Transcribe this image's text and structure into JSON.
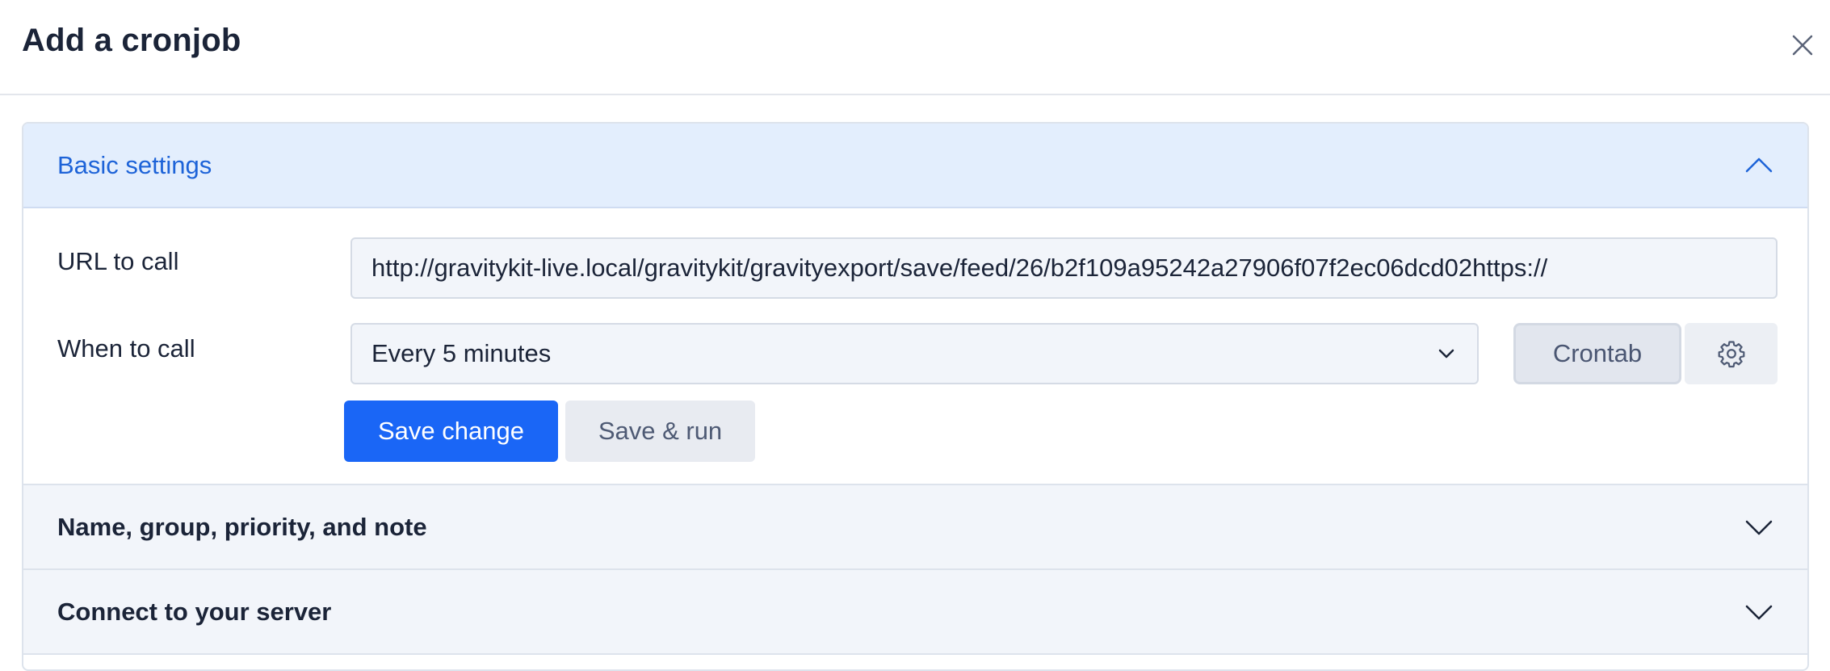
{
  "dialog": {
    "title": "Add a cronjob",
    "close_icon": "close-icon"
  },
  "sections": {
    "basic": {
      "title": "Basic settings",
      "expanded": true,
      "url_label": "URL to call",
      "url_value": "http://gravitykit-live.local/gravitykit/gravityexport/save/feed/26/b2f109a95242a27906f07f2ec06dcd02https://",
      "when_label": "When to call",
      "when_value": "Every 5 minutes",
      "crontab_label": "Crontab",
      "gear_icon": "gear-icon",
      "save_label": "Save change",
      "save_run_label": "Save & run"
    },
    "name_group": {
      "title": "Name, group, priority, and note",
      "expanded": false
    },
    "connect": {
      "title": "Connect to your server",
      "expanded": false
    }
  },
  "colors": {
    "primary": "#1a66f6",
    "section_active_bg": "#e3eefd",
    "section_active_text": "#1d63d8"
  }
}
